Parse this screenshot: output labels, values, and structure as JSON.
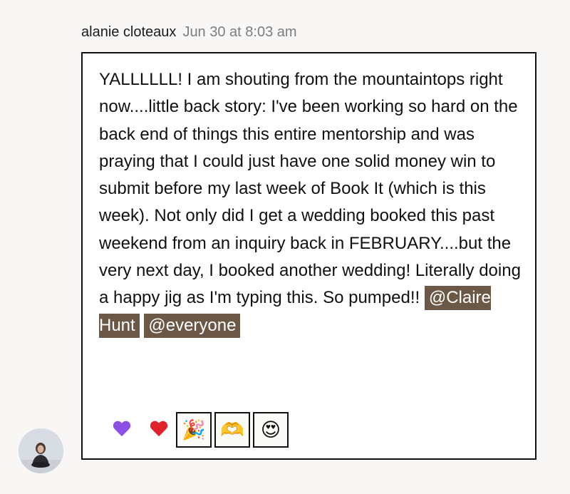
{
  "post": {
    "author": "alanie cloteaux",
    "timestamp": "Jun 30 at 8:03 am",
    "body_text": "YALLLLLL! I am shouting from the mountaintops right now....little back story: I've been working so hard on the back end of things this entire mentorship and was praying that I could just have one solid money win to submit before my last week of Book It (which is this week). Not only did I get a wedding booked this past weekend from an inquiry back in FEBRUARY....but the very next day, I booked another wedding! Literally doing a happy jig as I'm typing this. So pumped!!",
    "mentions": [
      "@Claire Hunt",
      "@everyone"
    ],
    "mention_color": "#6c5846"
  },
  "reactions": [
    {
      "icon": "purple-heart",
      "glyph": "",
      "color": "#8e4fe6",
      "selected": false
    },
    {
      "icon": "red-heart",
      "glyph": "",
      "color": "#e2222b",
      "selected": false
    },
    {
      "icon": "party-popper",
      "glyph": "🎉",
      "selected": true
    },
    {
      "icon": "heart-hands",
      "glyph": "🫶",
      "selected": true
    },
    {
      "icon": "heart-eyes-face",
      "glyph": "😍",
      "selected": true
    }
  ]
}
